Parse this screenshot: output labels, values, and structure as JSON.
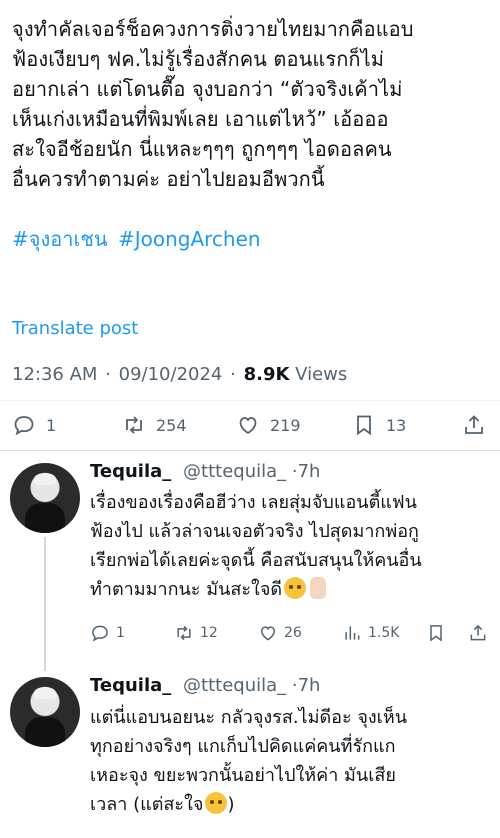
{
  "post": {
    "lines": [
      "จุงทำคัลเจอร์ช็อควงการติ่งวายไทยมากคือแอบ",
      "ฟ้องเงียบๆ ฟค.ไม่รู้เรื่องสักคน ตอนแรกก็ไม่",
      "อยากเล่า แต่โดนตื๊อ จุงบอกว่า “ตัวจริงเค้าไม่",
      "เห็นเก่งเหมือนที่พิมพ์เลย เอาแต่ไหว้” เอ้อออ",
      "สะใจอีช้อยนัก นี่แหละๆๆๆ ถูกๆๆๆ ไอดอลคน",
      "อื่นควรทำตามค่ะ อย่าไปยอมอีพวกนี้"
    ],
    "hashtags": [
      "#จุงอาเชน",
      "#JoongArchen"
    ],
    "translate": "Translate post",
    "time": "12:36 AM",
    "date": "09/10/2024",
    "views_count": "8.9K",
    "views_label": "Views",
    "stats": {
      "replies": "1",
      "reposts": "254",
      "likes": "219",
      "bookmarks": "13"
    }
  },
  "replies": [
    {
      "display_name": "Tequila_",
      "handle": "@tttequila_",
      "time": "·7h",
      "lines": [
        "เรื่องของเรื่องคือฮีว่าง เลยสุ่มจับแอนตี้แฟน",
        "ฟ้องไป แล้วล่าจนเจอตัวจริง ไปสุดมากพ่อกู",
        "เรียกพ่อได้เลยค่ะจุดนี้ คือสนับสนุนให้คนอื่น",
        "ทำตามมากนะ มันสะใจดี"
      ],
      "stats": {
        "replies": "1",
        "reposts": "12",
        "likes": "26",
        "views": "1.5K"
      }
    },
    {
      "display_name": "Tequila_",
      "handle": "@tttequila_",
      "time": "·7h",
      "lines": [
        "แต่นี่แอบนอยนะ กลัวจุงรส.ไม่ดีอะ จุงเห็น",
        "ทุกอย่างจริงๆ แกเก็บไปคิดแค่คนที่รักแก",
        "เหอะจุง ขยะพวกนั้นอย่าไปให้ค่า มันเสีย",
        "เวลา (แต่สะใจ",
        ")"
      ]
    }
  ],
  "colors": {
    "link": "#1d9bf0",
    "muted": "#536471",
    "text": "#0f1419"
  },
  "icons": [
    "reply-icon",
    "repost-icon",
    "like-icon",
    "bookmark-icon",
    "share-icon",
    "views-icon"
  ]
}
